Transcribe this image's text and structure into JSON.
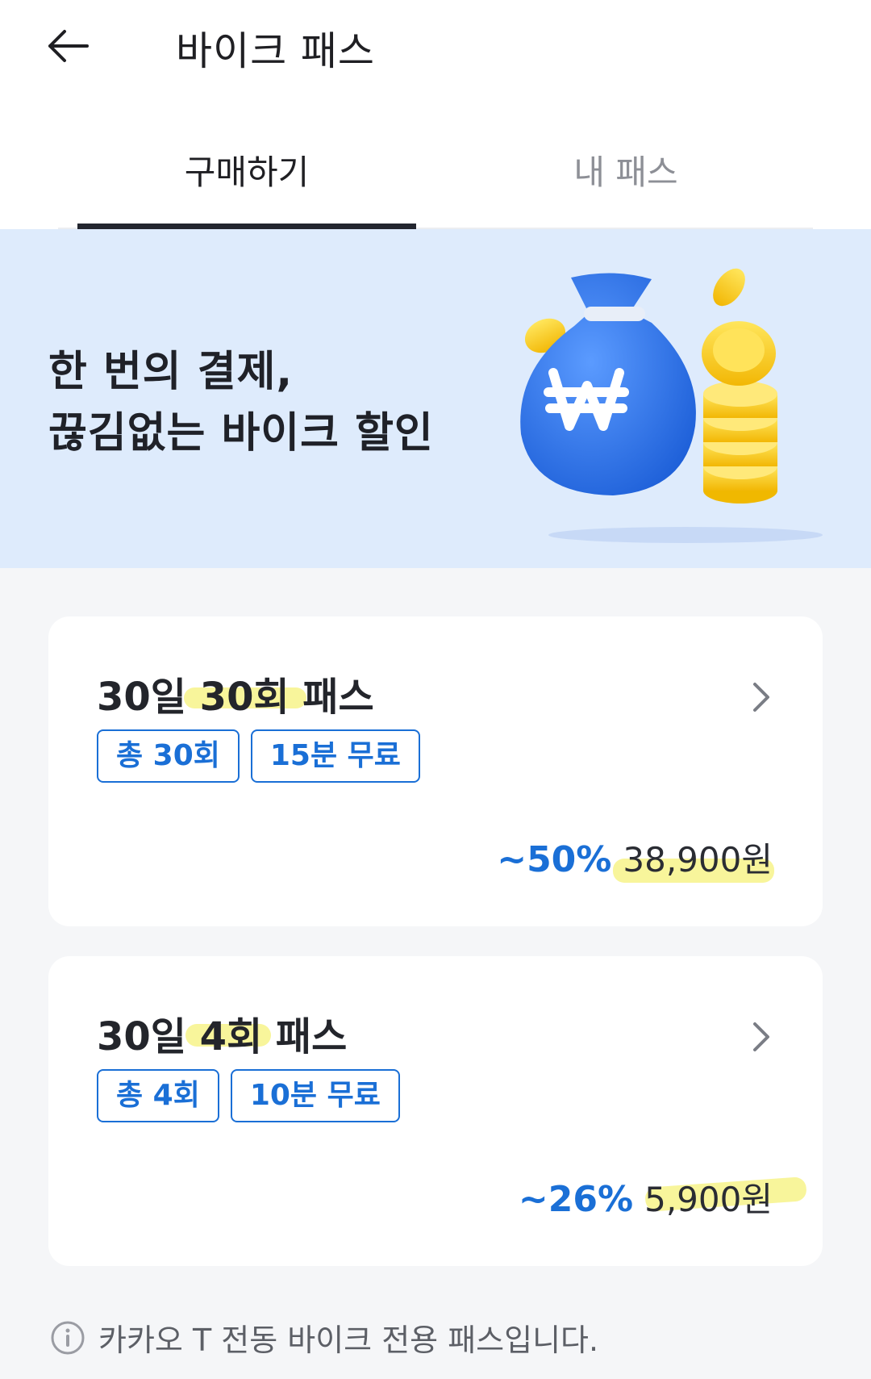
{
  "header": {
    "back_icon": "arrow-left-icon",
    "title": "바이크 패스"
  },
  "tabs": [
    {
      "label": "구매하기",
      "selected": true
    },
    {
      "label": "내 패스",
      "selected": false
    }
  ],
  "banner": {
    "line1": "한 번의 결제,",
    "line2": "끊김없는 바이크 할인",
    "illustration": "money-bag-coins-icon"
  },
  "passes": [
    {
      "title": "30일 30회 패스",
      "tags": [
        "총 30회",
        "15분 무료"
      ],
      "discount": "~50%",
      "price": "38,900원"
    },
    {
      "title": "30일 4회 패스",
      "tags": [
        "총 4회",
        "10분 무료"
      ],
      "discount": "~26%",
      "price": "5,900원"
    }
  ],
  "notice": {
    "icon": "info-icon",
    "text": "카카오 T 전동 바이크 전용 패스입니다."
  },
  "colors": {
    "accent": "#1a6fd6",
    "banner_bg": "#deebfc",
    "tab_indicator": "#23262f",
    "highlight": "#f6f27a"
  }
}
